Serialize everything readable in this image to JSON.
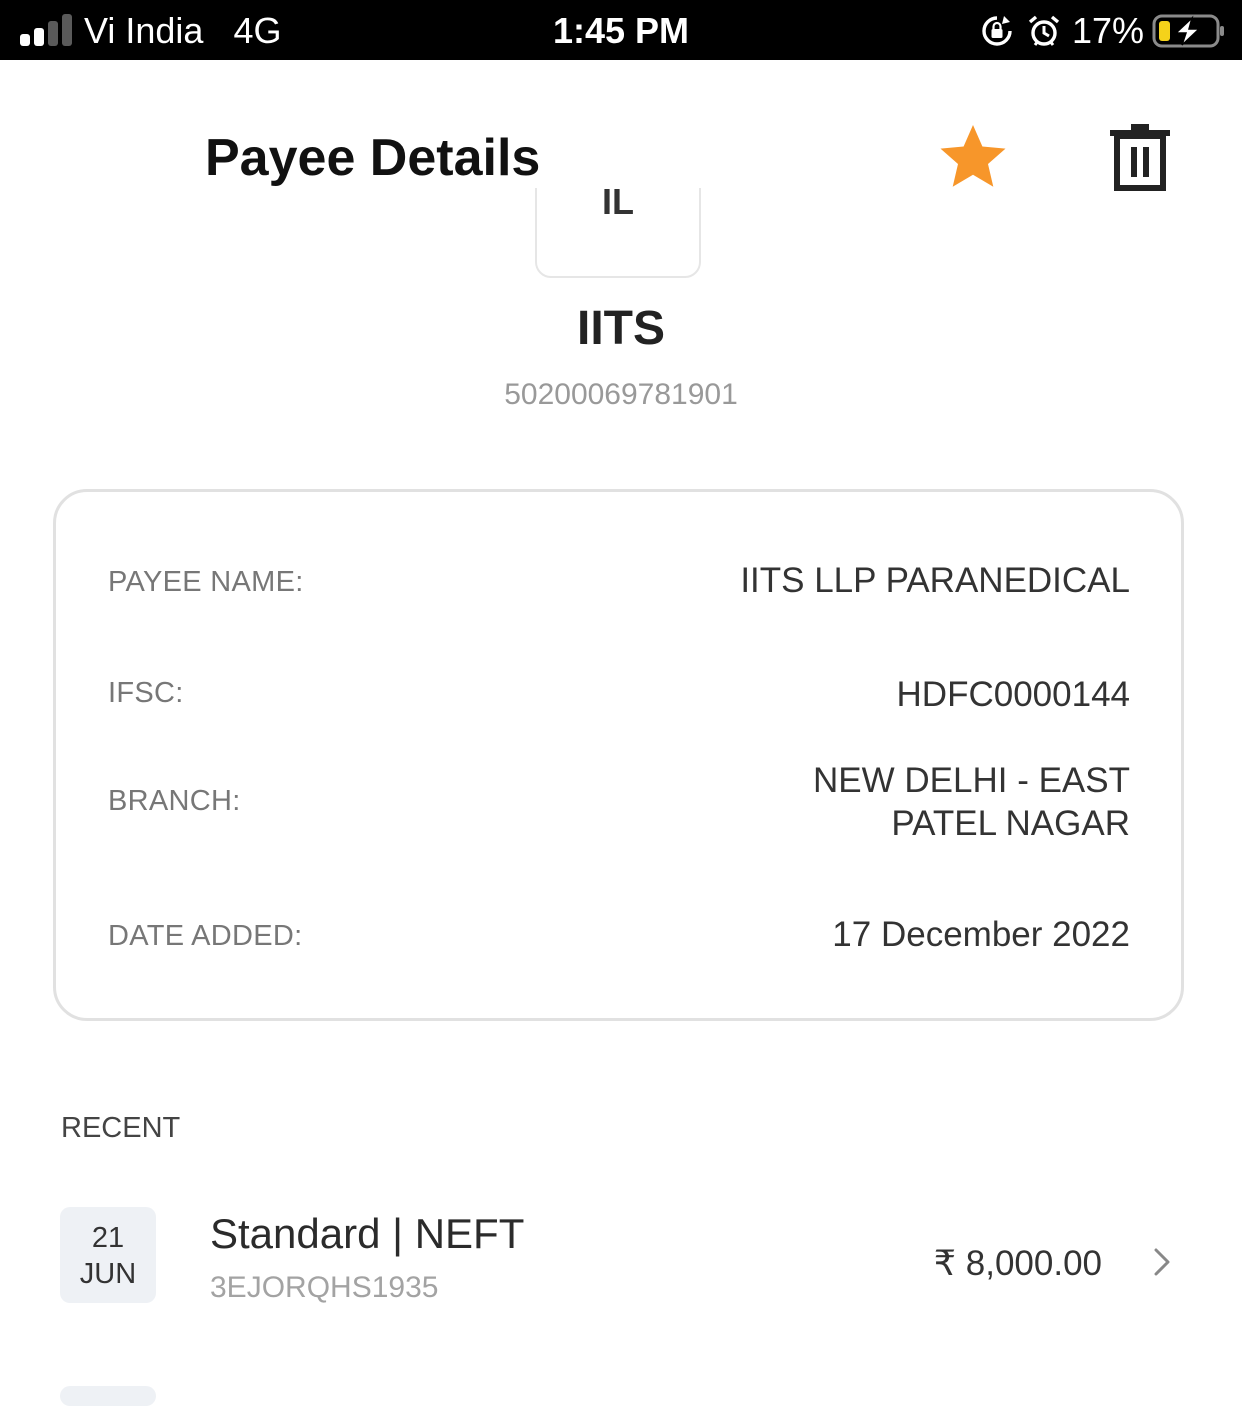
{
  "status_bar": {
    "carrier": "Vi India",
    "network": "4G",
    "time": "1:45 PM",
    "battery_percent": "17%",
    "battery_level": 0.17,
    "signal_bars_active": 2,
    "signal_bars_total": 4
  },
  "header": {
    "title": "Payee Details",
    "back_icon": "arrow-left-icon",
    "favorite_icon": "star-icon",
    "delete_icon": "trash-icon",
    "favorite_color": "#F7962A"
  },
  "payee": {
    "initials": "IL",
    "short_name": "IITS",
    "account_number": "50200069781901"
  },
  "details": {
    "payee_name_label": "PAYEE NAME:",
    "payee_name_value": "IITS LLP PARANEDICAL",
    "ifsc_label": "IFSC:",
    "ifsc_value": "HDFC0000144",
    "branch_label": "BRANCH:",
    "branch_value_line1": "NEW DELHI - EAST",
    "branch_value_line2": "PATEL NAGAR",
    "date_added_label": "DATE ADDED:",
    "date_added_value": "17 December 2022"
  },
  "recent": {
    "heading": "RECENT",
    "transactions": [
      {
        "day": "21",
        "month": "JUN",
        "title": "Standard | NEFT",
        "reference": "3EJORQHS1935",
        "amount": "₹ 8,000.00"
      }
    ]
  }
}
